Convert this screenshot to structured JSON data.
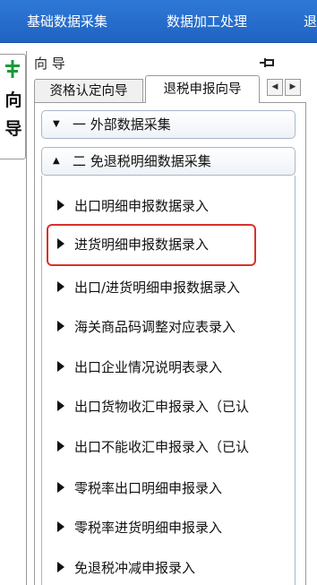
{
  "menubar": {
    "items": [
      "基础数据采集",
      "数据加工处理",
      "退"
    ]
  },
  "side_tab": {
    "label_1": "向",
    "label_2": "导"
  },
  "panel": {
    "title": "向 导",
    "tabs": [
      "资格认定向导",
      "退税申报向导"
    ],
    "active_tab": "退税申报向导"
  },
  "sections": [
    {
      "arrow": "▼",
      "label": "一  外部数据采集",
      "expanded": false
    },
    {
      "arrow": "▲",
      "label": "二  免退税明细数据采集",
      "expanded": true
    }
  ],
  "items": [
    "出口明细申报数据录入",
    "进货明细申报数据录入",
    "出口/进货明细申报数据录入",
    "海关商品码调整对应表录入",
    "出口企业情况说明表录入",
    "出口货物收汇申报录入（已认",
    "出口不能收汇申报录入（已认",
    "零税率出口明细申报录入",
    "零税率进货明细申报录入",
    "免退税冲减申报录入"
  ],
  "highlighted_item": "进货明细申报数据录入",
  "colors": {
    "menubar": "#2f79d6",
    "highlight_border": "#d8312b",
    "pin_icon": "#1a9a3a"
  }
}
